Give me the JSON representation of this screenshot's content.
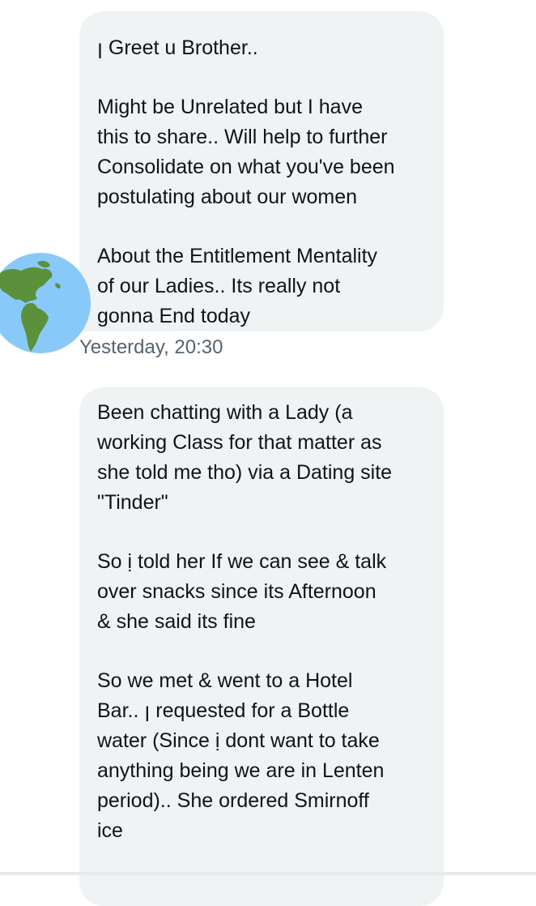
{
  "conversation": {
    "messages": [
      {
        "paragraphs": [
          "ꞁ Greet u Brother..",
          "Might be Unrelated but I have\nthis to share.. Will help to further\nConsolidate on what you've been\npostulating about our women",
          "About the Entitlement Mentality\nof our Ladies.. Its really not\ngonna End today"
        ],
        "timestamp": "Yesterday, 20:30"
      },
      {
        "paragraphs": [
          "Been chatting with a Lady (a\nworking Class for that matter as\nshe told me tho) via a Dating site\n\"Tinder\"",
          "So ị told her If we can see & talk\nover snacks since its Afternoon\n& she said its fine",
          "So we met & went to a Hotel\nBar.. ꞁ requested for a Bottle\nwater (Since ị dont want to take\nanything being we are in Lenten\nperiod).. She ordered Smirnoff\nice"
        ]
      }
    ],
    "avatar_icon": "globe-americas-icon",
    "colors": {
      "bubble": "#eff3f4",
      "text": "#0f1419",
      "timestamp": "#536471",
      "globe_ocean": "#88c9f9",
      "globe_land": "#5c913b"
    }
  }
}
